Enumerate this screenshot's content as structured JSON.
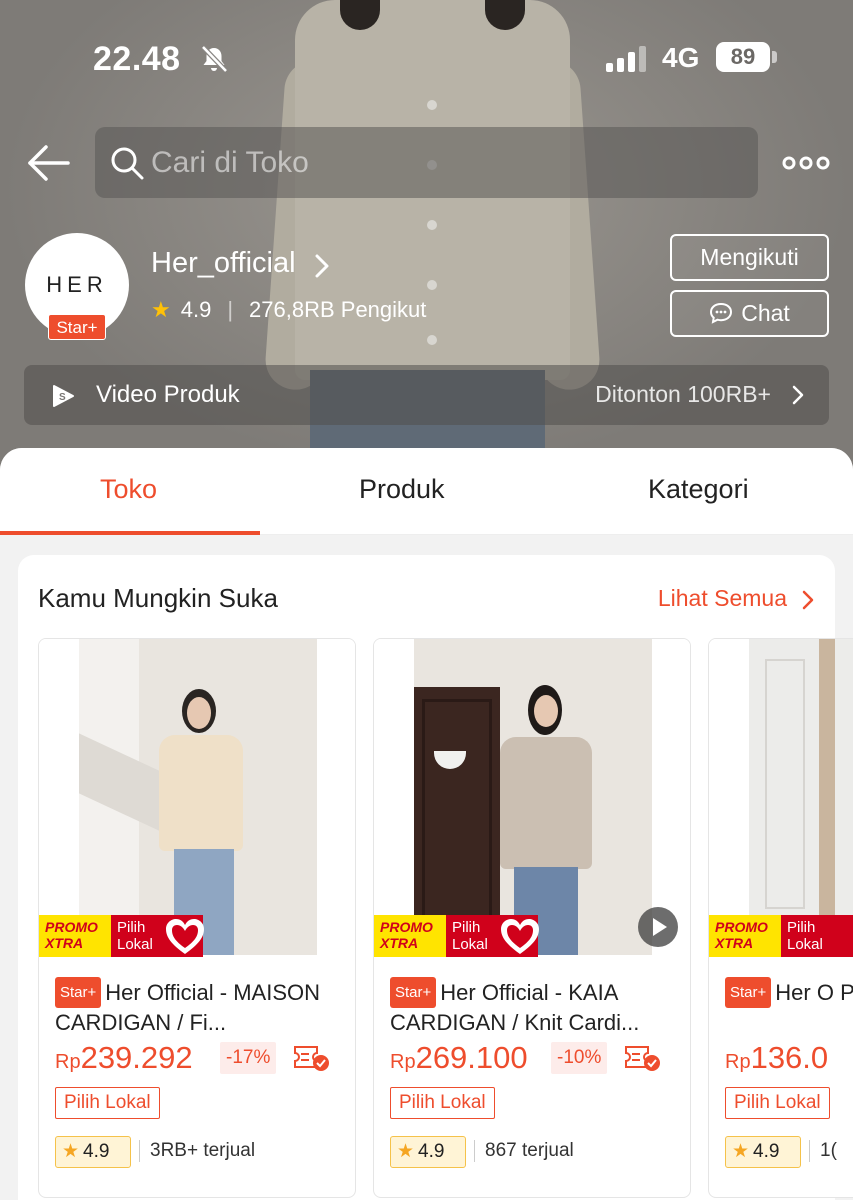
{
  "status": {
    "time": "22.48",
    "network": "4G",
    "battery": "89"
  },
  "search": {
    "placeholder": "Cari di Toko"
  },
  "shop": {
    "logo_text": "HER",
    "badge": "Star+",
    "name": "Her_official",
    "rating": "4.9",
    "followers": "276,8RB Pengikut",
    "follow_label": "Mengikuti",
    "chat_label": "Chat"
  },
  "video": {
    "label": "Video Produk",
    "count": "Ditonton 100RB+"
  },
  "tabs": [
    {
      "label": "Toko",
      "active": true
    },
    {
      "label": "Produk",
      "active": false
    },
    {
      "label": "Kategori",
      "active": false
    }
  ],
  "section": {
    "title": "Kamu Mungkin Suka",
    "see_all": "Lihat Semua"
  },
  "promo": {
    "xtra_line1": "PROMO",
    "xtra_line2": "XTRA",
    "lokal_line1": "Pilih",
    "lokal_line2": "Lokal"
  },
  "products": [
    {
      "badge": "Star+",
      "title": "Her Official - MAISON CARDIGAN / Fi...",
      "currency": "Rp",
      "price": "239.292",
      "discount": "-17%",
      "tag": "Pilih Lokal",
      "rating": "4.9",
      "sold": "3RB+ terjual"
    },
    {
      "badge": "Star+",
      "title": "Her Official -  KAIA CARDIGAN / Knit Cardi...",
      "currency": "Rp",
      "price": "269.100",
      "discount": "-10%",
      "tag": "Pilih Lokal",
      "rating": "4.9",
      "sold": "867 terjual"
    },
    {
      "badge": "Star+",
      "title": "Her O PANTS / H",
      "currency": "Rp",
      "price": "136.0",
      "discount": "",
      "tag": "Pilih Lokal",
      "rating": "4.9",
      "sold": "1("
    }
  ],
  "colors": {
    "accent": "#ee4d2d",
    "star": "#ffc107"
  }
}
